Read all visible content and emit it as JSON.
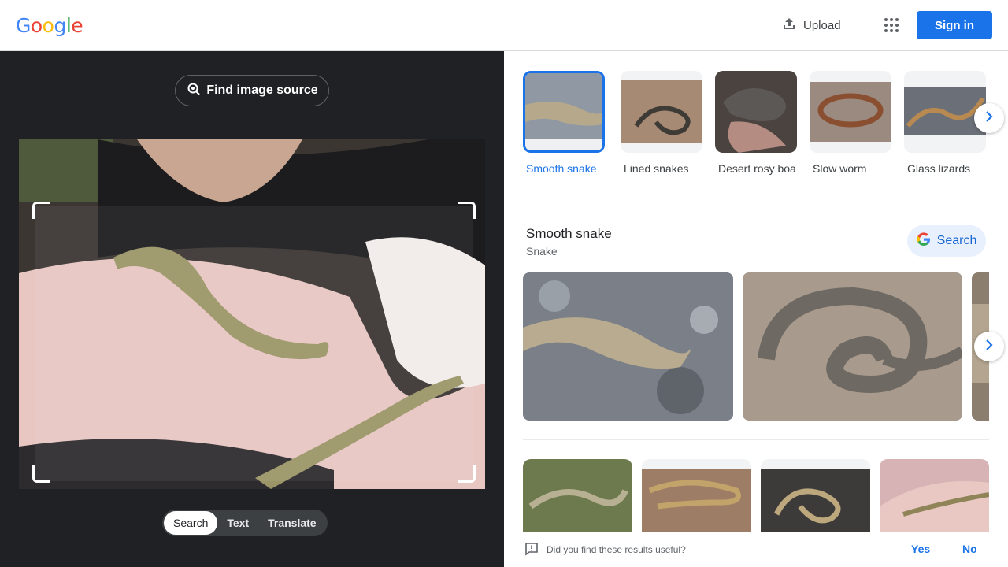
{
  "header": {
    "logo_letters": [
      "G",
      "o",
      "o",
      "g",
      "l",
      "e"
    ],
    "upload_label": "Upload",
    "signin_label": "Sign in",
    "icons": [
      "upload-icon",
      "apps-grid-icon"
    ]
  },
  "lens": {
    "find_source_label": "Find image source",
    "mode_tabs": [
      {
        "label": "Search",
        "active": true
      },
      {
        "label": "Text",
        "active": false
      },
      {
        "label": "Translate",
        "active": false
      }
    ]
  },
  "results": {
    "chips": [
      {
        "label": "Smooth snake",
        "active": true
      },
      {
        "label": "Lined snakes",
        "active": false
      },
      {
        "label": "Desert rosy boa",
        "active": false
      },
      {
        "label": "Slow worm",
        "active": false
      },
      {
        "label": "Glass lizards",
        "active": false
      }
    ],
    "entity": {
      "title": "Smooth snake",
      "subtitle": "Snake",
      "search_label": "Search"
    },
    "feedback": {
      "question": "Did you find these results useful?",
      "yes": "Yes",
      "no": "No"
    }
  },
  "colors": {
    "accent": "#1a73e8",
    "dark_pane": "#202124",
    "google_blue": "#4285f4",
    "google_red": "#ea4335",
    "google_yellow": "#fbbc05",
    "google_green": "#34a853"
  }
}
